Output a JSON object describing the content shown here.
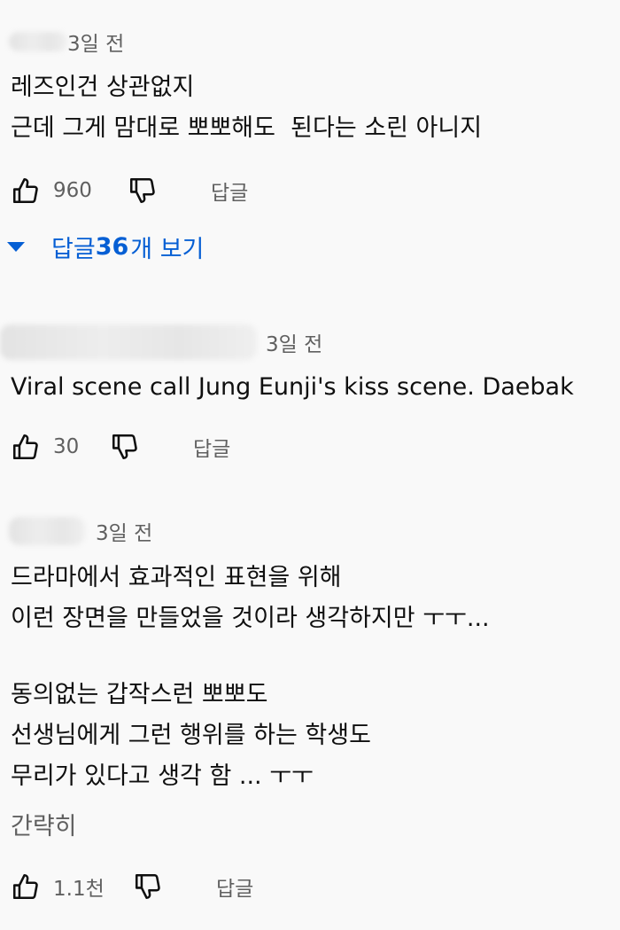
{
  "comments": [
    {
      "time": "3일 전",
      "lines": [
        "레즈인건 상관없지",
        "근데 그게 맘대로 뽀뽀해도  된다는 소린 아니지"
      ],
      "likes": "960",
      "reply_label": "답글"
    },
    {
      "time": "3일 전",
      "lines": [
        "Viral scene call Jung Eunji's kiss scene. Daebak"
      ],
      "likes": "30",
      "reply_label": "답글"
    },
    {
      "time": "3일 전",
      "lines": [
        "드라마에서 효과적인 표현을 위해",
        "이런 장면을 만들었을 것이라 생각하지만 ㅜㅜ...",
        "",
        "동의없는 갑작스런 뽀뽀도",
        "선생님에게 그런 행위를 하는 학생도",
        "무리가 있다고 생각 함 ... ㅜㅜ"
      ],
      "likes": "1.1천",
      "reply_label": "답글",
      "collapse_label": "간략히"
    }
  ],
  "view_replies": {
    "prefix": "답글 ",
    "count": "36",
    "suffix": "개 보기"
  },
  "icons": {
    "like": "thumb-up-icon",
    "dislike": "thumb-down-icon",
    "expand": "caret-down-icon"
  },
  "colors": {
    "background": "#f9f9f9",
    "link": "#065fd4",
    "secondary": "#606060"
  }
}
